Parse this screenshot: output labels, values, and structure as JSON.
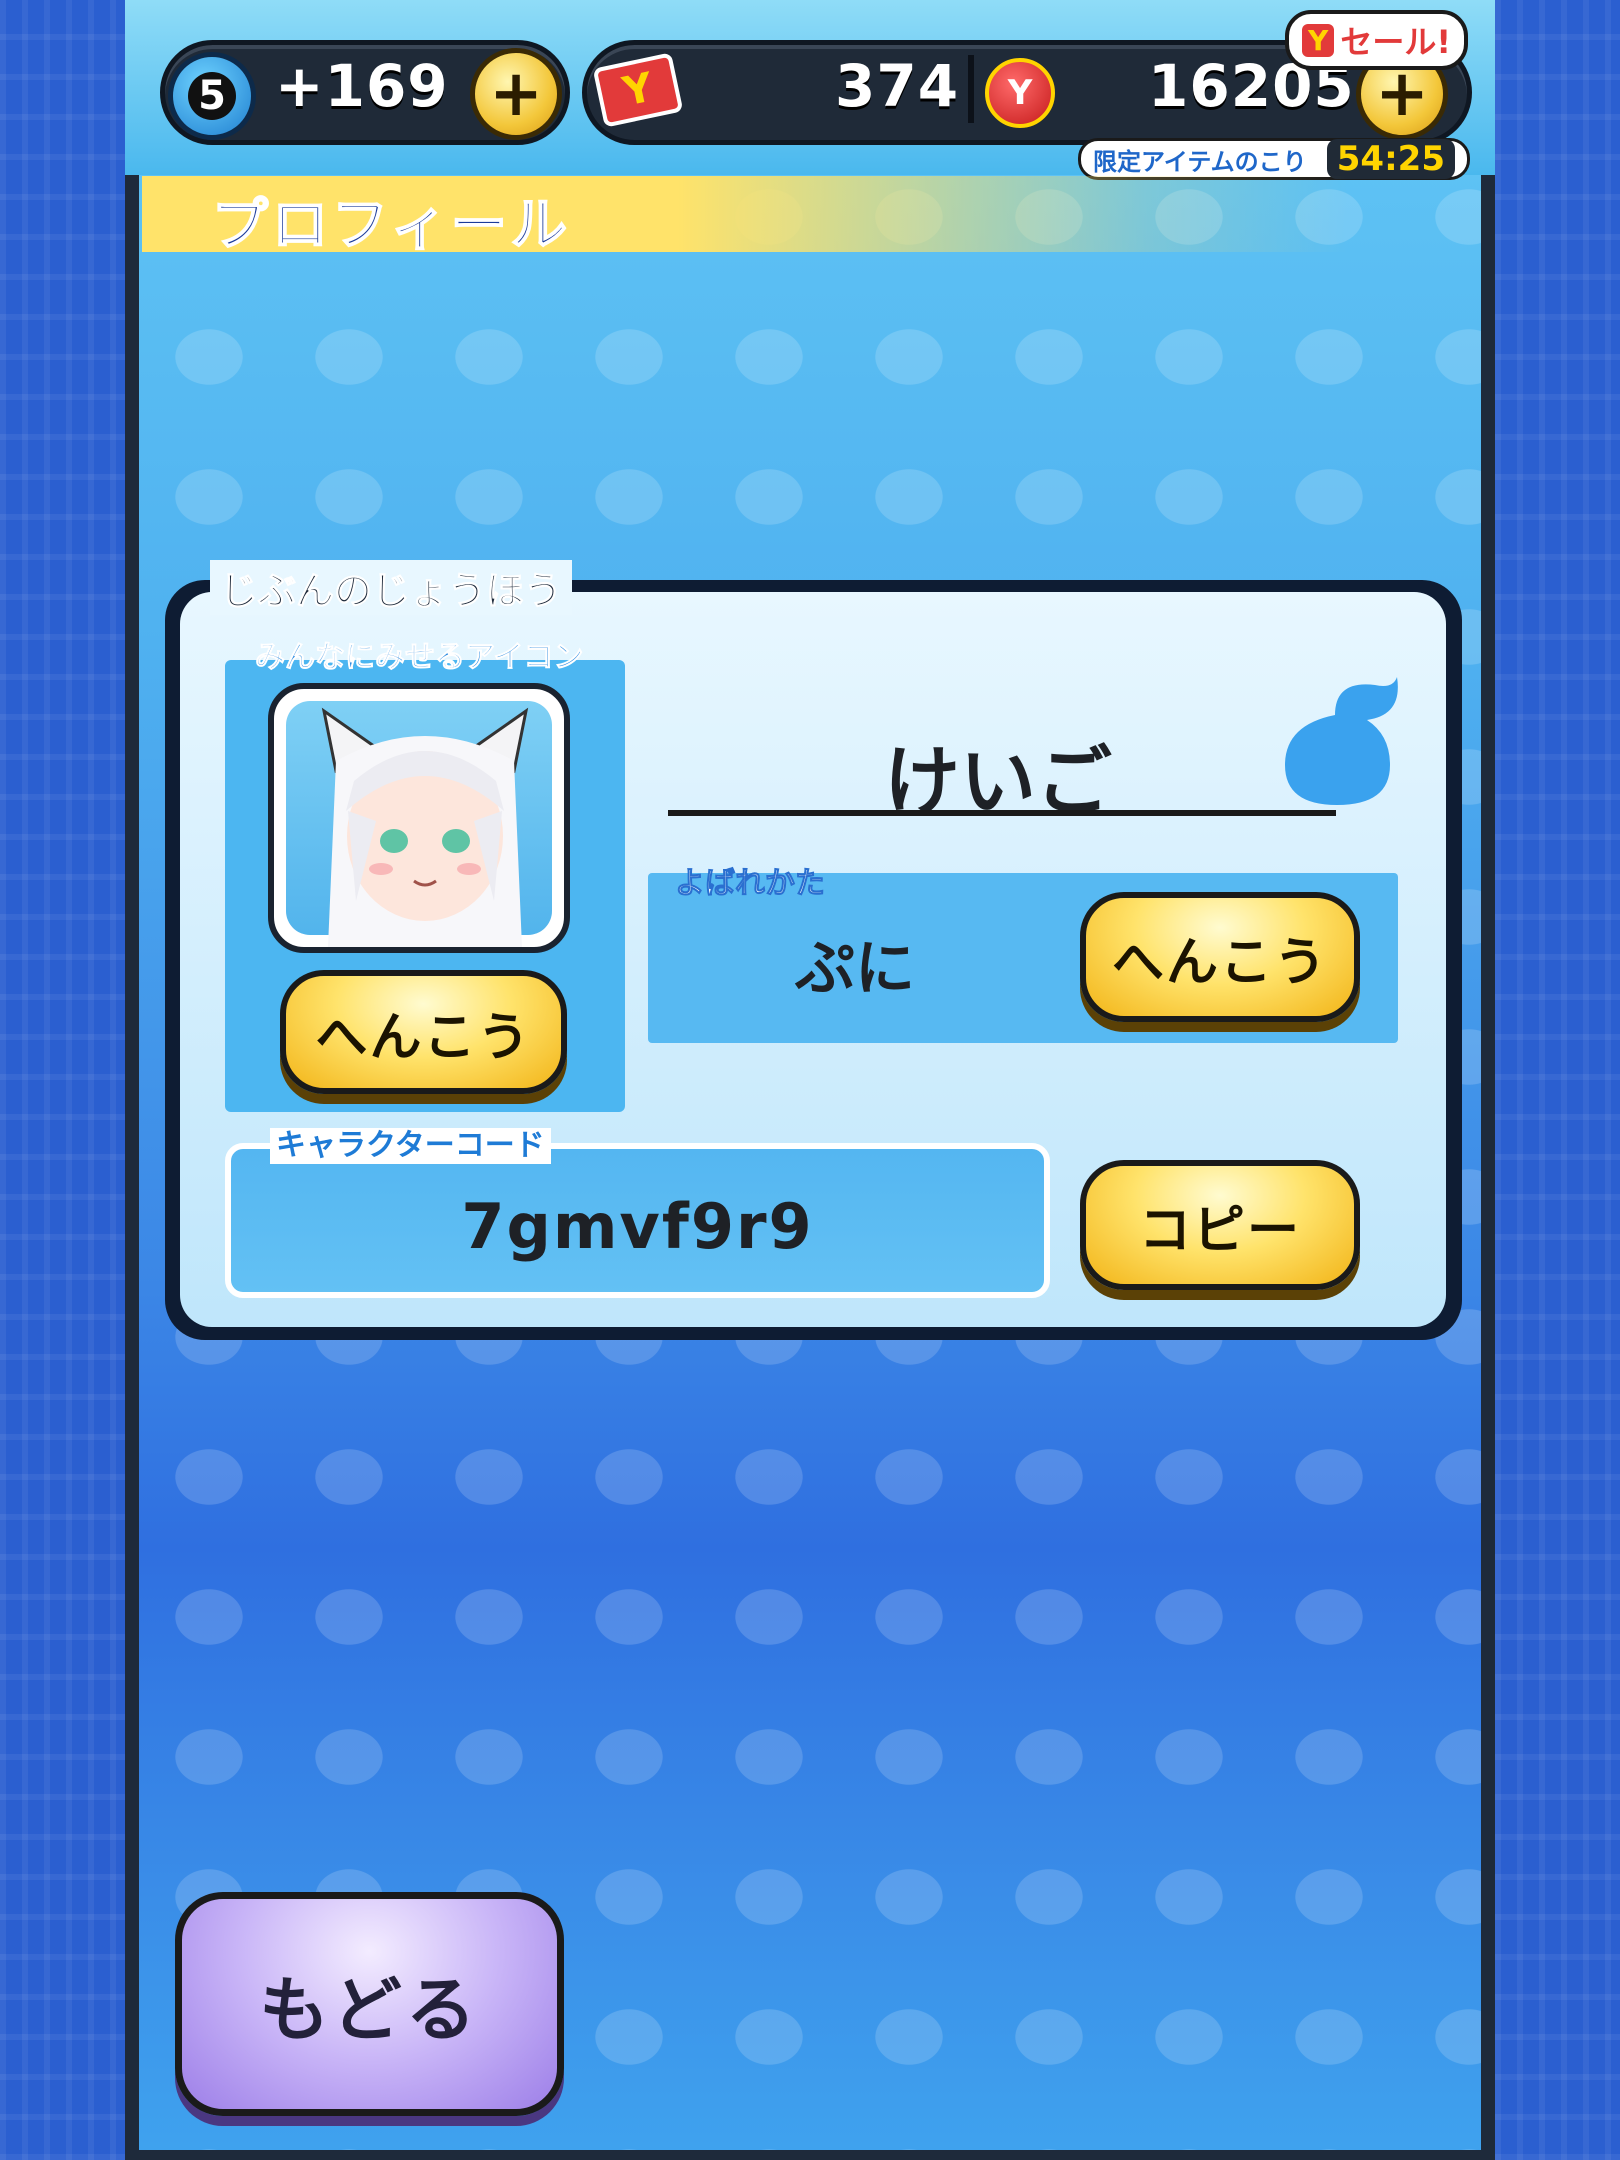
{
  "hud": {
    "stamina_level": "5",
    "stamina_value": "+169",
    "ticket_value": "374",
    "currency_value": "16205",
    "plus_label": "+",
    "ticket_symbol": "Y",
    "coin_symbol": "Y",
    "sale_symbol": "Y",
    "sale_label": "セール!",
    "limited_item_label": "限定アイテムのこり",
    "limited_item_timer": "54:25"
  },
  "screen": {
    "title": "プロフィール"
  },
  "profile": {
    "section_label": "じぶんのじょうほう",
    "icon_label": "みんなにみせるアイコン",
    "icon_change_label": "へんこう",
    "name": "けいご",
    "nickname_label": "よばれかた",
    "nickname": "ぷに",
    "nickname_change_label": "へんこう",
    "character_code_label": "キャラクターコード",
    "character_code": "7gmvf9r9",
    "copy_label": "コピー"
  },
  "footer": {
    "back_label": "もどる"
  },
  "colors": {
    "accent_yellow": "#ffe36b",
    "panel_blue": "#4cb6f1",
    "back_purple": "#c8b4f7",
    "title_blue": "#1b3b9a"
  },
  "icons": [
    "spirit-icon",
    "ticket-icon",
    "coin-icon",
    "plus-icon",
    "avatar-icon"
  ]
}
